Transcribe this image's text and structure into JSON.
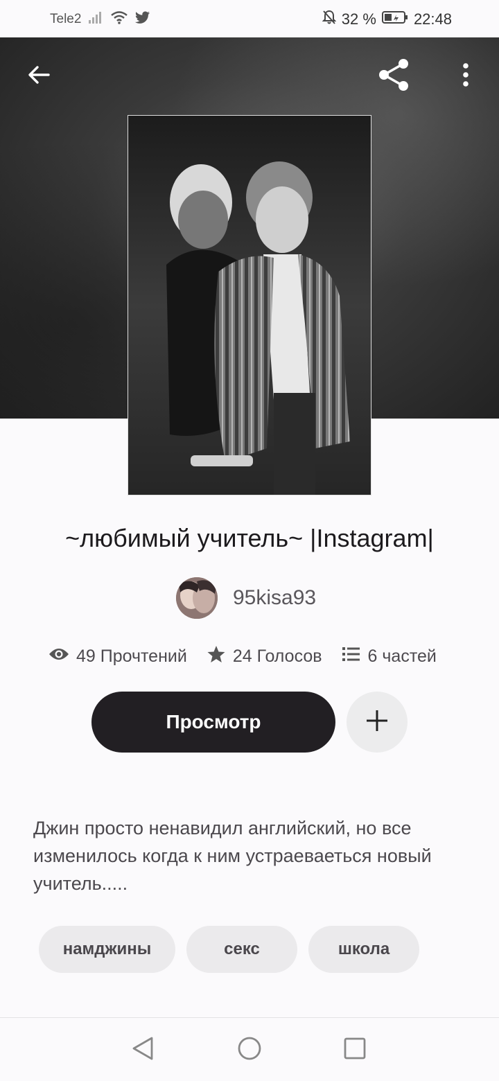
{
  "status_bar": {
    "carrier": "Tele2",
    "battery_percent": "32 %",
    "time": "22:48",
    "icons": [
      "signal-icon",
      "wifi-icon",
      "twitter-icon",
      "mute-icon",
      "battery-icon"
    ]
  },
  "toolbar": {
    "back_icon": "arrow-left-icon",
    "share_icon": "share-icon",
    "more_icon": "more-vertical-icon"
  },
  "story": {
    "title": "~любимый учитель~ |Instagram|",
    "author": "95kisa93",
    "stats": {
      "reads": "49 Прочтений",
      "votes": "24 Голосов",
      "parts": "6 частей"
    },
    "read_button_label": "Просмотр",
    "add_icon": "plus-icon",
    "description": "Джин просто ненавидил английский, но все изменилось когда к ним устраеваеться новый учитель.....",
    "tags": [
      "намджины",
      "секс",
      "школа"
    ]
  },
  "nav_bar": {
    "icons": [
      "nav-back-icon",
      "nav-home-icon",
      "nav-recent-icon"
    ]
  }
}
